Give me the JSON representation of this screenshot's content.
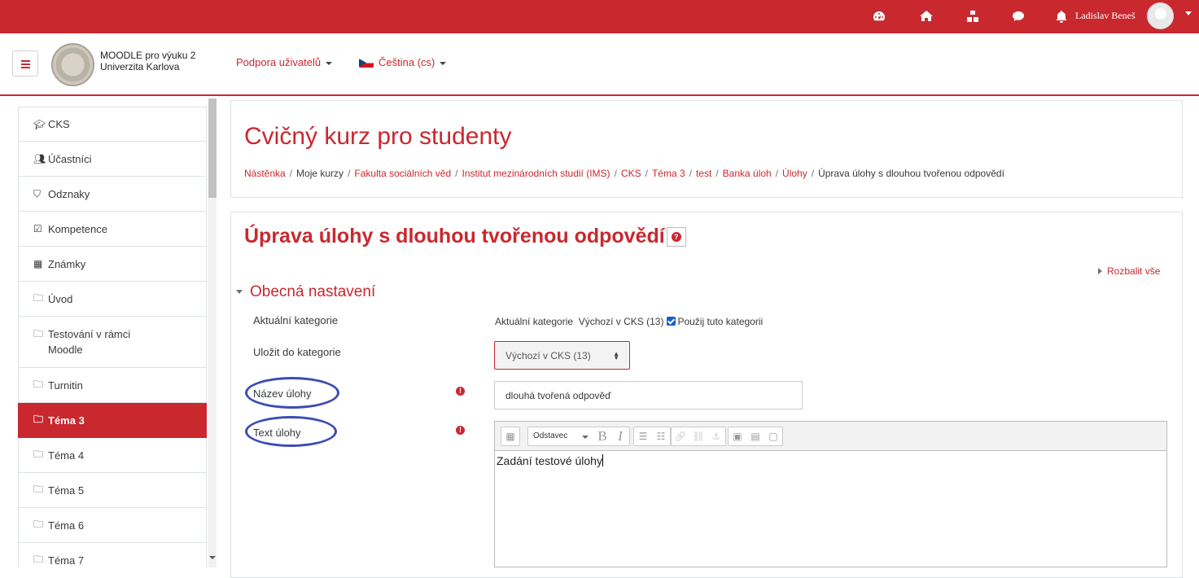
{
  "topbar": {
    "icons": [
      "dashboard-icon",
      "home-icon",
      "cubes-icon",
      "chat-icon",
      "bell-icon"
    ],
    "user_name": "Ladislav Beneš"
  },
  "navbar": {
    "site_line1": "MOODLE pro výuku 2",
    "site_line2": "Univerzita Karlova",
    "support_menu": "Podpora uživatelů",
    "language_menu": "Čeština (cs)"
  },
  "sidebar": {
    "items": [
      {
        "label": "CKS",
        "icon": "graduation-cap-icon"
      },
      {
        "label": "Účastníci",
        "icon": "users-icon"
      },
      {
        "label": "Odznaky",
        "icon": "shield-icon"
      },
      {
        "label": "Kompetence",
        "icon": "checkbox-icon"
      },
      {
        "label": "Známky",
        "icon": "table-icon"
      },
      {
        "label": "Úvod",
        "icon": "folder-icon"
      },
      {
        "label": "Testování v rámci Moodle",
        "icon": "folder-icon"
      },
      {
        "label": "Turnitin",
        "icon": "folder-icon"
      },
      {
        "label": "Téma 3",
        "icon": "folder-icon",
        "active": true
      },
      {
        "label": "Téma 4",
        "icon": "folder-icon"
      },
      {
        "label": "Téma 5",
        "icon": "folder-icon"
      },
      {
        "label": "Téma 6",
        "icon": "folder-icon"
      },
      {
        "label": "Téma 7",
        "icon": "folder-icon"
      }
    ]
  },
  "header": {
    "course_title": "Cvičný kurz pro studenty",
    "breadcrumb": [
      "Nástěnka",
      "Moje kurzy",
      "Fakulta sociálních věd",
      "Institut mezinárodních studií (IMS)",
      "CKS",
      "Téma 3",
      "test",
      "Banka úloh",
      "Úlohy",
      "Úprava úlohy s dlouhou tvořenou odpovědí"
    ]
  },
  "main": {
    "page_heading": "Úprava úlohy s dlouhou tvořenou odpovědí",
    "expand_all": "Rozbalit vše",
    "section_heading": "Obecná nastavení",
    "fields": {
      "current_category_label": "Aktuální kategorie",
      "current_category_prefix": "Aktuální kategorie",
      "current_category_value": "Výchozí v CKS (13)",
      "use_category_checkbox": "Použij tuto kategorii",
      "use_category_checked": true,
      "save_to_category_label": "Uložit do kategorie",
      "save_to_category_value": "Výchozí v CKS (13)",
      "question_name_label": "Název úlohy",
      "question_name_value": "dlouhá tvořená odpověď",
      "question_text_label": "Text úlohy",
      "question_text_value": "Zadání testové úlohy"
    },
    "editor_toolbar": {
      "paragraph_select": "Odstavec"
    }
  },
  "colors": {
    "brand": "#c9282f",
    "annotation": "#3b4bb5"
  }
}
